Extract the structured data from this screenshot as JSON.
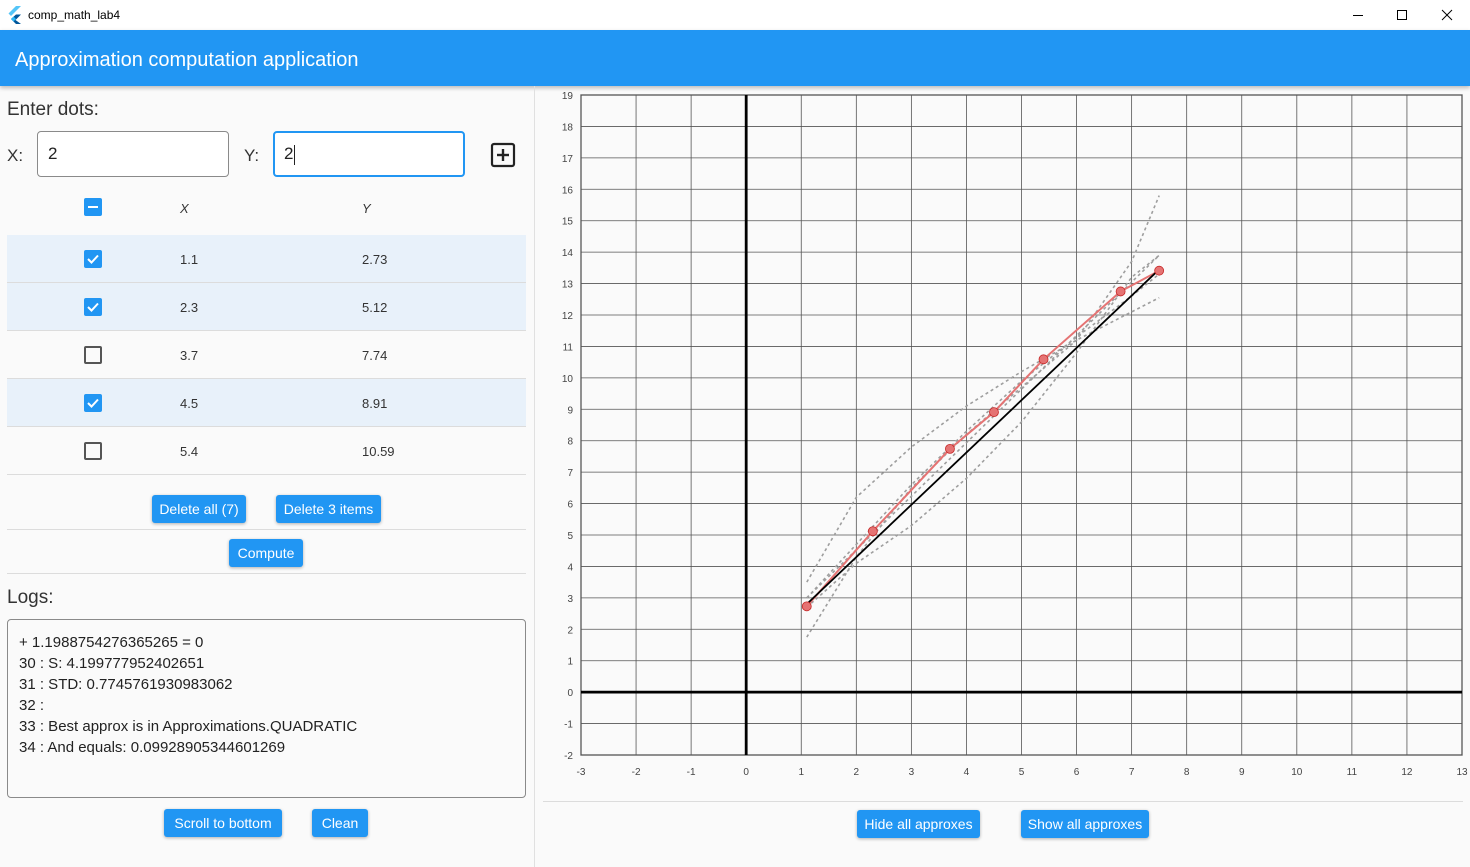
{
  "window": {
    "title": "comp_math_lab4"
  },
  "appbar": {
    "title": "Approximation computation application"
  },
  "input_section": {
    "heading": "Enter dots:",
    "x_label": "X:",
    "y_label": "Y:",
    "x_value": "2",
    "y_value": "2"
  },
  "table": {
    "col_x": "X",
    "col_y": "Y",
    "rows": [
      {
        "x": "1.1",
        "y": "2.73",
        "checked": true
      },
      {
        "x": "2.3",
        "y": "5.12",
        "checked": true
      },
      {
        "x": "3.7",
        "y": "7.74",
        "checked": false
      },
      {
        "x": "4.5",
        "y": "8.91",
        "checked": true
      },
      {
        "x": "5.4",
        "y": "10.59",
        "checked": false
      }
    ]
  },
  "actions": {
    "delete_all": "Delete all (7)",
    "delete_items": "Delete 3 items",
    "compute": "Compute"
  },
  "logs": {
    "heading": "Logs:",
    "lines": [
      "+ 1.1988754276365265 = 0",
      "30 : S: 4.199777952402651",
      "31 : STD: 0.7745761930983062",
      "32 :",
      "33 : Best approx is in Approximations.QUADRATIC",
      "34 : And equals: 0.09928905344601269"
    ],
    "scroll_button": "Scroll to bottom",
    "clean_button": "Clean"
  },
  "chart_buttons": {
    "hide": "Hide all approxes",
    "show": "Show all approxes"
  },
  "colors": {
    "primary": "#2196f3",
    "selected_row": "#e8f1fa",
    "point": "#e57373",
    "approx": "#9e9e9e"
  },
  "chart_data": {
    "type": "scatter",
    "xlim": [
      -3,
      13
    ],
    "ylim": [
      -2,
      19
    ],
    "x_ticks": [
      -3,
      -2,
      -1,
      0,
      1,
      2,
      3,
      4,
      5,
      6,
      7,
      8,
      9,
      10,
      11,
      12,
      13
    ],
    "y_ticks": [
      -2,
      -1,
      0,
      1,
      2,
      3,
      4,
      5,
      6,
      7,
      8,
      9,
      10,
      11,
      12,
      13,
      14,
      15,
      16,
      17,
      18,
      19
    ],
    "grid": true,
    "points": [
      {
        "x": 1.1,
        "y": 2.73
      },
      {
        "x": 2.3,
        "y": 5.12
      },
      {
        "x": 3.7,
        "y": 7.74
      },
      {
        "x": 4.5,
        "y": 8.91
      },
      {
        "x": 5.4,
        "y": 10.59
      },
      {
        "x": 6.8,
        "y": 12.75
      },
      {
        "x": 7.5,
        "y": 13.41
      }
    ],
    "best_fit": {
      "x": [
        1.1,
        7.5
      ],
      "y": [
        2.8,
        13.45
      ]
    },
    "approx_curves": [
      {
        "x": [
          1.1,
          2.0,
          3.0,
          4.0,
          5.0,
          6.0,
          7.0,
          7.5
        ],
        "y": [
          3.0,
          4.7,
          6.6,
          8.3,
          9.9,
          11.3,
          12.6,
          13.3
        ]
      },
      {
        "x": [
          1.1,
          7.5
        ],
        "y": [
          3.0,
          13.9
        ]
      },
      {
        "x": [
          1.1,
          2.0,
          3.0,
          4.0,
          5.0,
          6.0,
          7.0,
          7.5
        ],
        "y": [
          1.75,
          4.3,
          6.5,
          8.2,
          9.7,
          11.2,
          13.7,
          15.8
        ]
      },
      {
        "x": [
          1.1,
          2.0,
          3.0,
          4.0,
          5.0,
          6.0,
          7.0,
          7.5
        ],
        "y": [
          3.5,
          6.2,
          7.8,
          9.1,
          10.2,
          11.2,
          12.1,
          12.55
        ]
      },
      {
        "x": [
          1.1,
          2.0,
          3.0,
          4.0,
          5.0,
          6.0,
          7.0,
          7.5
        ],
        "y": [
          2.7,
          4.1,
          5.3,
          6.8,
          8.6,
          10.8,
          13.2,
          13.9
        ]
      }
    ]
  }
}
